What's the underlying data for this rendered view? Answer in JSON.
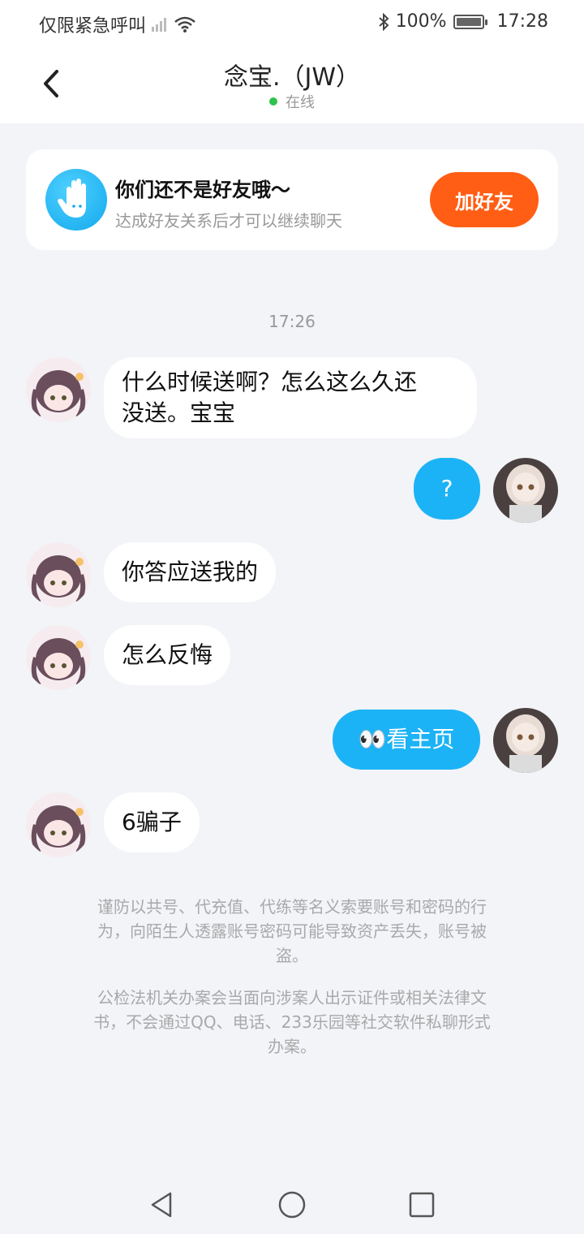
{
  "status_bar": {
    "carrier": "仅限紧急呼叫",
    "battery": "100%",
    "time": "17:28",
    "icons": [
      "signal-icon",
      "wifi-icon",
      "bluetooth-icon",
      "battery-icon"
    ]
  },
  "header": {
    "title": "念宝.（JW）",
    "presence": "在线",
    "presence_color": "#2fc24c"
  },
  "friend_card": {
    "title": "你们还不是好友哦～",
    "subtitle": "达成好友关系后才可以继续聊天",
    "add_button": "加好友",
    "button_color": "#ff5e14",
    "icon": "wave-hand-icon"
  },
  "chat": {
    "timestamp": "17:26",
    "messages": [
      {
        "side": "left",
        "text_line1": "什么时候送啊？怎么这么久还",
        "text_line2": "没送。宝宝"
      },
      {
        "side": "right",
        "text": "?"
      },
      {
        "side": "left",
        "text": "你答应送我的"
      },
      {
        "side": "left",
        "text": "怎么反悔"
      },
      {
        "side": "right",
        "emoji": "👀",
        "text": "看主页"
      },
      {
        "side": "left",
        "text": "6骗子"
      }
    ],
    "outgoing_color": "#1cb3f6"
  },
  "notices": {
    "line1": "谨防以共号、代充值、代练等名义索要账号和密码的行",
    "line2": "为，向陌生人透露账号密码可能导致资产丢失，账号被",
    "line3": "盗。",
    "line4": "公检法机关办案会当面向涉案人出示证件或相关法律文",
    "line5": "书，不会通过QQ、电话、233乐园等社交软件私聊形式",
    "line6": "办案。"
  },
  "nav": {
    "back": "back-triangle-icon",
    "home": "home-circle-icon",
    "recents": "recents-square-icon"
  }
}
